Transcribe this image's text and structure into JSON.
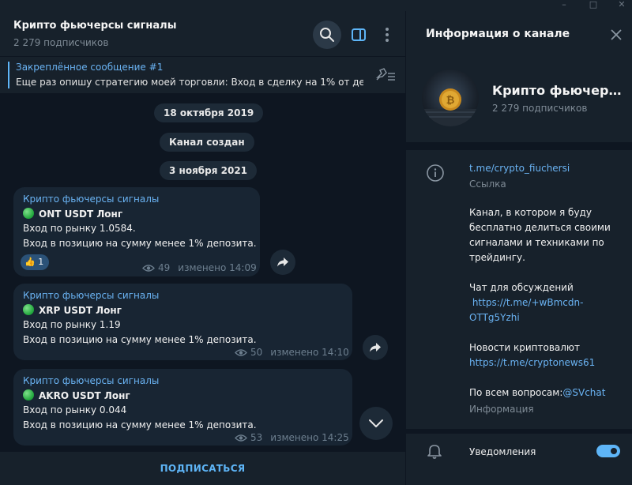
{
  "chat": {
    "title": "Крипто фьючерсы сигналы",
    "subscribers": "2 279 подписчиков",
    "pinned": {
      "title": "Закреплённое сообщение #1",
      "text": "Еще раз опишу стратегию моей торговли: Вход в сделку на 1% от де..."
    },
    "service": {
      "date1": "18 октября 2019",
      "created": "Канал создан",
      "date2": "3 ноября 2021"
    },
    "messages": [
      {
        "author": "Крипто фьючерсы сигналы",
        "headline": "ONT USDT Лонг",
        "entry": "Вход по рынку 1.0584.",
        "position": "Вход в позицию на сумму менее 1% депозита.",
        "reaction_emoji": "👍",
        "reaction_count": "1",
        "views": "49",
        "time": "изменено 14:09"
      },
      {
        "author": "Крипто фьючерсы сигналы",
        "headline": "XRP USDT  Лонг",
        "entry": "Вход по рынку 1.19",
        "position": "Вход в позицию на сумму менее 1% депозита.",
        "views": "50",
        "time": "изменено 14:10"
      },
      {
        "author": "Крипто фьючерсы сигналы",
        "headline": "AKRO USDT Лонг",
        "entry": "Вход по рынку 0.044",
        "position": "Вход в позицию на сумму менее 1% депозита.",
        "views": "53",
        "time": "изменено 14:25"
      }
    ],
    "subscribe_label": "ПОДПИСАТЬСЯ"
  },
  "info": {
    "panel_title": "Информация о канале",
    "channel_name": "Крипто фьючерсы...",
    "subscribers": "2 279 подписчиков",
    "link": "t.me/crypto_fiuchersi",
    "link_caption": "Ссылка",
    "desc_lines": [
      "Канал, в котором я буду",
      "бесплатно делиться своими",
      "сигналами и техниками по",
      "трейдингу."
    ],
    "chat_label": "Чат для обсуждений",
    "chat_link_1": " https://t.me/+wBmcdn-",
    "chat_link_2": "OTTg5Yzhi",
    "news_label": "Новости криптовалют",
    "news_link": "https://t.me/cryptonews61",
    "questions_label": "По всем вопросам:",
    "questions_handle": "@SVchat",
    "info_caption": "Информация",
    "notifications_label": "Уведомления",
    "notifications_on": true
  },
  "colors": {
    "accent": "#5eb5f7",
    "link": "#6ab3f3",
    "background": "#0e1621",
    "panel": "#17212b",
    "bubble": "#182533"
  },
  "icons": [
    "search-icon",
    "sidebar-panel-icon",
    "more-vertical-icon",
    "unpin-list-icon",
    "share-arrow-icon",
    "eye-icon",
    "chevron-down-icon",
    "close-icon",
    "info-icon",
    "bell-icon",
    "minimize-icon",
    "maximize-icon",
    "window-close-icon"
  ]
}
